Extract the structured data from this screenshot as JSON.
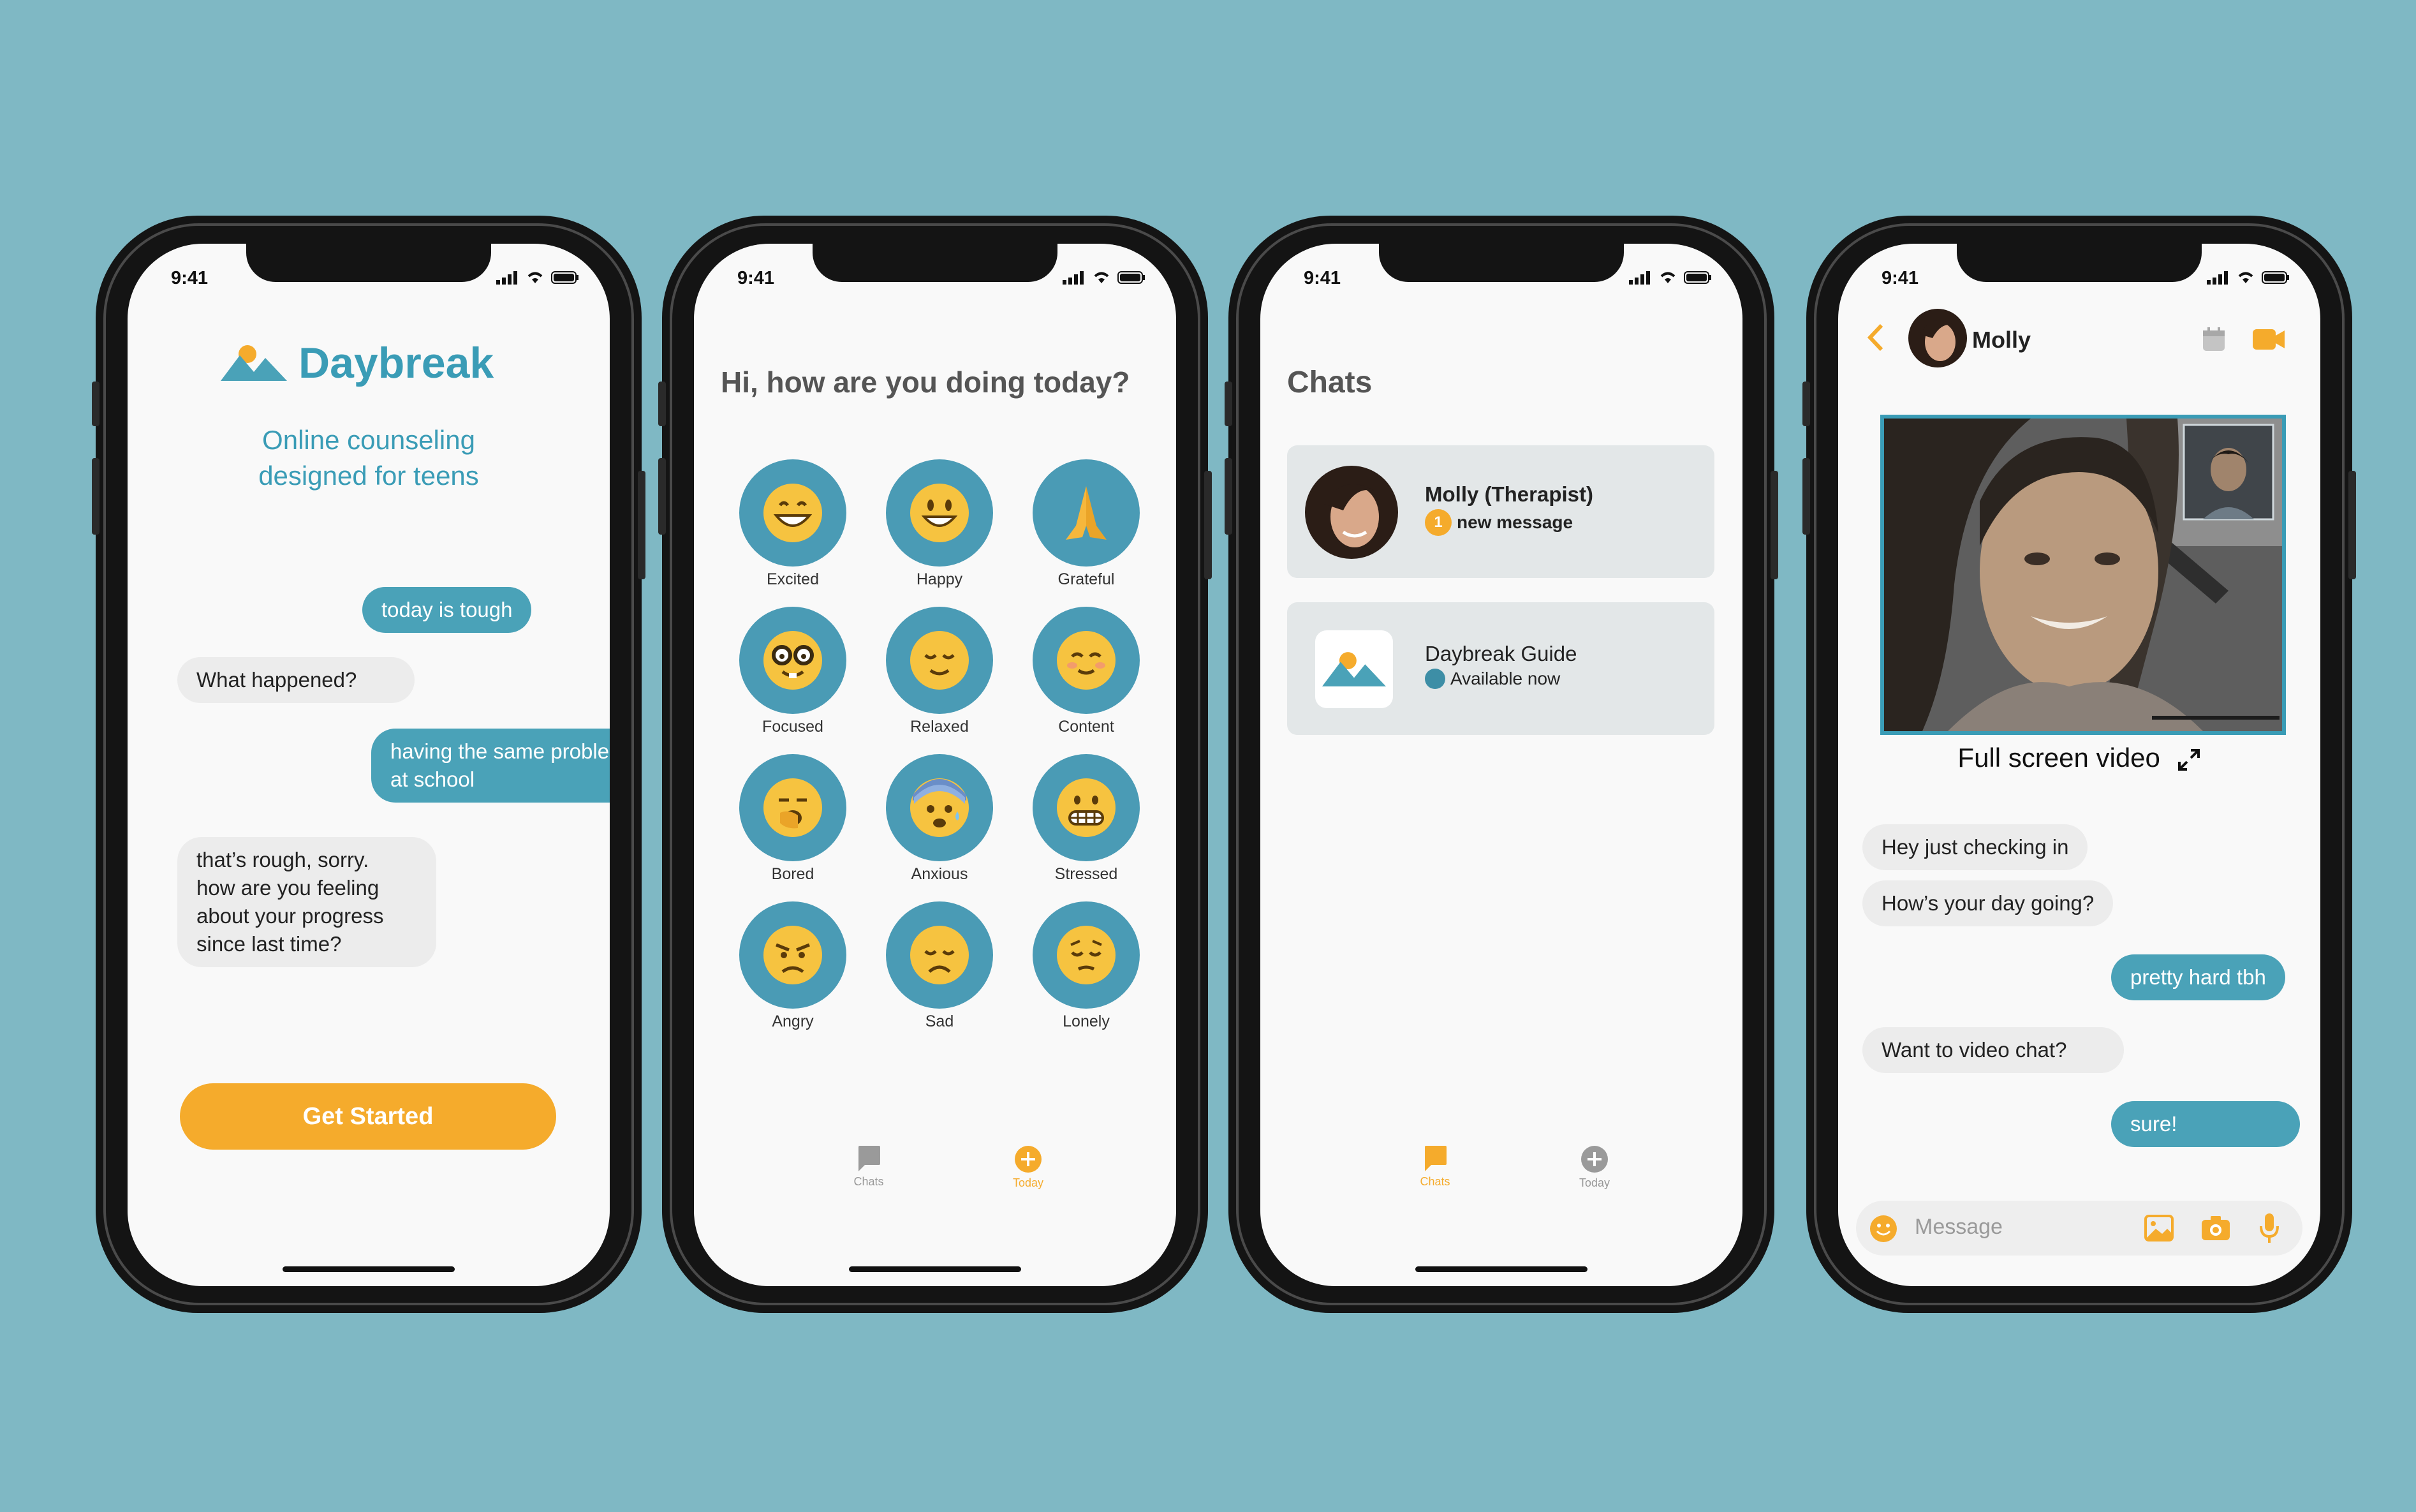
{
  "status": {
    "time": "9:41"
  },
  "screen1": {
    "brand": "Daybreak",
    "tagline_line1": "Online counseling",
    "tagline_line2": "designed for teens",
    "messages": [
      {
        "from": "user",
        "text": "today is tough"
      },
      {
        "from": "bot",
        "text": "What happened?"
      },
      {
        "from": "user",
        "line1": "having the same problem",
        "line2": "at school"
      },
      {
        "from": "bot",
        "line1": "that’s rough, sorry.",
        "line2": "how are you feeling",
        "line3": "about your progress",
        "line4": "since last time?"
      }
    ],
    "cta": "Get Started"
  },
  "screen2": {
    "greeting": "Hi, how are you doing today?",
    "moods": [
      "Excited",
      "Happy",
      "Grateful",
      "Focused",
      "Relaxed",
      "Content",
      "Bored",
      "Anxious",
      "Stressed",
      "Angry",
      "Sad",
      "Lonely"
    ],
    "tabs": {
      "chats": "Chats",
      "today": "Today",
      "active": "Today"
    }
  },
  "screen3": {
    "title": "Chats",
    "conversations": [
      {
        "name": "Molly (Therapist)",
        "badge": "1",
        "subtitle": "new message"
      },
      {
        "name": "Daybreak Guide",
        "subtitle": "Available now"
      }
    ],
    "tabs": {
      "chats": "Chats",
      "today": "Today",
      "active": "Chats"
    }
  },
  "screen4": {
    "contact": "Molly",
    "video_caption": "Full screen video",
    "messages": [
      {
        "from": "therapist",
        "text": "Hey just checking in"
      },
      {
        "from": "therapist",
        "text": "How’s your day going?"
      },
      {
        "from": "user",
        "text": "pretty hard tbh"
      },
      {
        "from": "therapist",
        "text": "Want to video chat?"
      },
      {
        "from": "user",
        "text": "sure!"
      }
    ],
    "composer_placeholder": "Message"
  },
  "colors": {
    "background": "#7fb8c4",
    "teal": "#4aa2b8",
    "orange": "#f5ab2c",
    "bubble_grey": "#ececec",
    "card_grey": "#e3e7e8"
  },
  "icons": [
    "cellular-icon",
    "wifi-icon",
    "battery-icon",
    "daybreak-logo-icon",
    "chat-bubble-icon",
    "add-circle-icon",
    "back-chevron-icon",
    "calendar-icon",
    "video-camera-icon",
    "expand-icon",
    "emoji-icon",
    "image-icon",
    "camera-icon",
    "microphone-icon"
  ]
}
